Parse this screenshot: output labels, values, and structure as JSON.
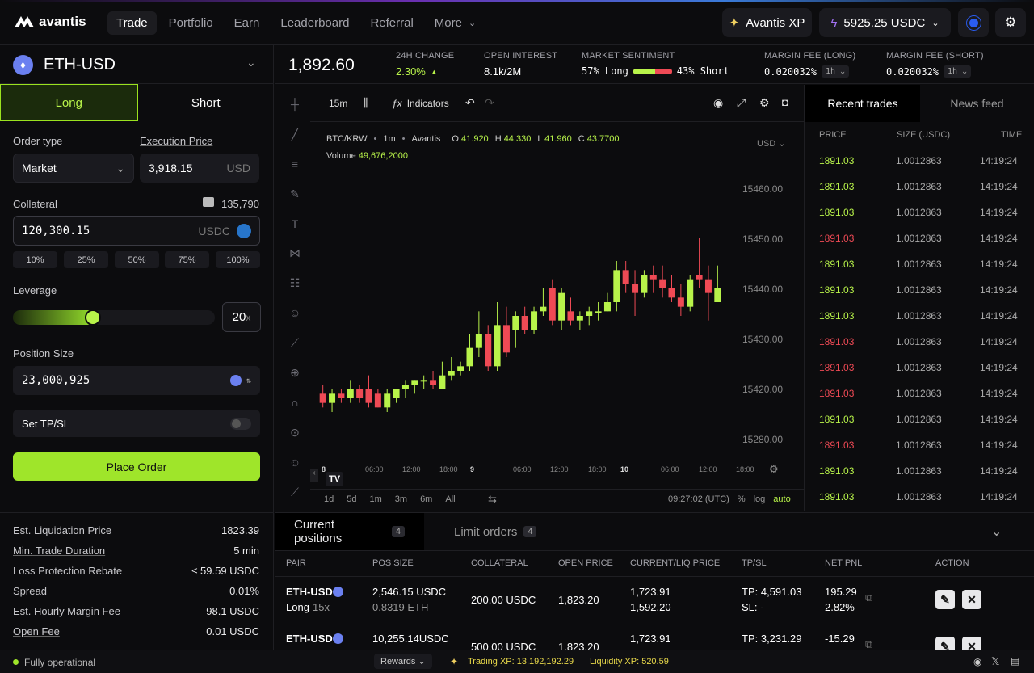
{
  "nav": {
    "brand": "avantis",
    "links": [
      "Trade",
      "Portfolio",
      "Earn",
      "Leaderboard",
      "Referral",
      "More"
    ],
    "xp_label": "Avantis XP",
    "balance": "5925.25 USDC"
  },
  "pair": {
    "name": "ETH-USD"
  },
  "order": {
    "tab_long": "Long",
    "tab_short": "Short",
    "order_type_label": "Order type",
    "order_type": "Market",
    "exec_price_label": "Execution Price",
    "exec_price": "3,918.15",
    "exec_unit": "USD",
    "collateral_label": "Collateral",
    "wallet_balance": "135,790",
    "collateral": "120,300.15",
    "collateral_unit": "USDC",
    "pcts": [
      "10%",
      "25%",
      "50%",
      "75%",
      "100%"
    ],
    "leverage_label": "Leverage",
    "leverage": "20",
    "leverage_unit": "x",
    "leverage_fill": 0.38,
    "size_label": "Position Size",
    "size": "23,000,925",
    "tpsl_label": "Set TP/SL",
    "place": "Place Order"
  },
  "stats": {
    "price": "1,892.60",
    "change_label": "24H CHANGE",
    "change": "2.30%",
    "oi_label": "OPEN INTEREST",
    "oi": "8.1k/2M",
    "sent_label": "MARKET SENTIMENT",
    "long": "57% Long",
    "short": "43% Short",
    "long_frac": 0.57,
    "fee_long_label": "MARGIN FEE (LONG)",
    "fee_long": "0.020032%",
    "fee_short_label": "MARGIN FEE (SHORT)",
    "fee_short": "0.020032%",
    "interval": "1h"
  },
  "chart": {
    "interval": "15m",
    "indicators": "Indicators",
    "legend_pair": "BTC/KRW",
    "legend_tf": "1m",
    "legend_src": "Avantis",
    "o": "41.920",
    "h": "44.330",
    "l": "41.960",
    "c": "43.7700",
    "volume_label": "Volume",
    "volume": "49,676,2000",
    "currency": "USD",
    "yticks": [
      "15460.00",
      "15450.00",
      "15440.00",
      "15430.00",
      "15420.00",
      "15280.00"
    ],
    "xticks": [
      "8",
      "06:00",
      "12:00",
      "18:00",
      "9",
      "06:00",
      "12:00",
      "18:00",
      "10",
      "06:00",
      "12:00",
      "18:00"
    ],
    "ranges": [
      "1d",
      "5d",
      "1m",
      "3m",
      "6m",
      "All"
    ],
    "time": "09:27:02 (UTC)",
    "pct": "%",
    "log": "log",
    "auto": "auto"
  },
  "chart_data": {
    "type": "candlestick",
    "yunit": "USD",
    "ylim": [
      15410,
      15470
    ],
    "candles": [
      [
        15423,
        15425,
        15420,
        15421
      ],
      [
        15421,
        15424,
        15419,
        15423
      ],
      [
        15423,
        15424,
        15421,
        15422
      ],
      [
        15422,
        15426,
        15421,
        15424
      ],
      [
        15424,
        15425,
        15421,
        15422
      ],
      [
        15424,
        15427,
        15420,
        15421
      ],
      [
        15423,
        15424,
        15420,
        15420
      ],
      [
        15420,
        15424,
        15419,
        15423
      ],
      [
        15422,
        15424,
        15421,
        15424
      ],
      [
        15424,
        15426,
        15422,
        15425
      ],
      [
        15425,
        15426,
        15423,
        15426
      ],
      [
        15426,
        15427,
        15424,
        15426
      ],
      [
        15426,
        15428,
        15424,
        15425
      ],
      [
        15424,
        15430,
        15424,
        15427
      ],
      [
        15427,
        15431,
        15426,
        15428
      ],
      [
        15428,
        15430,
        15427,
        15429
      ],
      [
        15429,
        15436,
        15428,
        15433
      ],
      [
        15433,
        15441,
        15431,
        15436
      ],
      [
        15436,
        15438,
        15428,
        15429
      ],
      [
        15429,
        15443,
        15428,
        15438
      ],
      [
        15438,
        15442,
        15431,
        15432
      ],
      [
        15437,
        15441,
        15433,
        15440
      ],
      [
        15440,
        15442,
        15436,
        15437
      ],
      [
        15437,
        15442,
        15436,
        15441
      ],
      [
        15441,
        15446,
        15440,
        15442
      ],
      [
        15446,
        15448,
        15438,
        15439
      ],
      [
        15439,
        15446,
        15437,
        15445
      ],
      [
        15441,
        15444,
        15438,
        15439
      ],
      [
        15439,
        15441,
        15437,
        15440
      ],
      [
        15440,
        15442,
        15438,
        15441
      ],
      [
        15441,
        15443,
        15439,
        15441
      ],
      [
        15441,
        15445,
        15441,
        15443
      ],
      [
        15443,
        15452,
        15441,
        15450
      ],
      [
        15450,
        15452,
        15445,
        15447
      ],
      [
        15447,
        15450,
        15440,
        15445
      ],
      [
        15445,
        15450,
        15444,
        15449
      ],
      [
        15449,
        15451,
        15445,
        15448
      ],
      [
        15448,
        15451,
        15444,
        15446
      ],
      [
        15446,
        15449,
        15443,
        15444
      ],
      [
        15444,
        15447,
        15440,
        15442
      ],
      [
        15442,
        15449,
        15441,
        15448
      ],
      [
        15449,
        15457,
        15446,
        15448
      ],
      [
        15448,
        15451,
        15439,
        15445
      ],
      [
        15443,
        15451,
        15443,
        15446
      ]
    ]
  },
  "trades": {
    "tab1": "Recent trades",
    "tab2": "News feed",
    "h_price": "PRICE",
    "h_size": "SIZE (USDC)",
    "h_time": "TIME",
    "rows": [
      {
        "p": "1891.03",
        "s": "1.0012863",
        "t": "14:19:24",
        "side": "g"
      },
      {
        "p": "1891.03",
        "s": "1.0012863",
        "t": "14:19:24",
        "side": "g"
      },
      {
        "p": "1891.03",
        "s": "1.0012863",
        "t": "14:19:24",
        "side": "g"
      },
      {
        "p": "1891.03",
        "s": "1.0012863",
        "t": "14:19:24",
        "side": "r"
      },
      {
        "p": "1891.03",
        "s": "1.0012863",
        "t": "14:19:24",
        "side": "g"
      },
      {
        "p": "1891.03",
        "s": "1.0012863",
        "t": "14:19:24",
        "side": "g"
      },
      {
        "p": "1891.03",
        "s": "1.0012863",
        "t": "14:19:24",
        "side": "g"
      },
      {
        "p": "1891.03",
        "s": "1.0012863",
        "t": "14:19:24",
        "side": "r"
      },
      {
        "p": "1891.03",
        "s": "1.0012863",
        "t": "14:19:24",
        "side": "r"
      },
      {
        "p": "1891.03",
        "s": "1.0012863",
        "t": "14:19:24",
        "side": "r"
      },
      {
        "p": "1891.03",
        "s": "1.0012863",
        "t": "14:19:24",
        "side": "g"
      },
      {
        "p": "1891.03",
        "s": "1.0012863",
        "t": "14:19:24",
        "side": "r"
      },
      {
        "p": "1891.03",
        "s": "1.0012863",
        "t": "14:19:24",
        "side": "g"
      },
      {
        "p": "1891.03",
        "s": "1.0012863",
        "t": "14:19:24",
        "side": "g"
      }
    ]
  },
  "info": {
    "rows": [
      {
        "k": "Est. Liquidation Price",
        "v": "1823.39",
        "ul": false,
        "c": ""
      },
      {
        "k": "Min. Trade Duration",
        "v": "5 min",
        "ul": true,
        "c": "yellow"
      },
      {
        "k": "Loss Protection Rebate",
        "v": "≤ 59.59 USDC",
        "ul": false,
        "c": "green"
      },
      {
        "k": "Spread",
        "v": "0.01%",
        "ul": false,
        "c": ""
      },
      {
        "k": "Est. Hourly Margin Fee",
        "v": "98.1 USDC",
        "ul": false,
        "c": ""
      },
      {
        "k": "Open Fee",
        "v": "0.01 USDC",
        "ul": true,
        "c": ""
      }
    ]
  },
  "positions": {
    "tab1": "Current positions",
    "n1": "4",
    "tab2": "Limit orders",
    "n2": "4",
    "headers": [
      "PAIR",
      "POS SIZE",
      "COLLATERAL",
      "OPEN PRICE",
      "CURRENT/LIQ PRICE",
      "TP/SL",
      "NET PNL",
      "ACTION"
    ],
    "rows": [
      {
        "pair": "ETH-USD",
        "side": "Long",
        "lev": "15x",
        "size": "2,546.15 USDC",
        "size2": "0.8319 ETH",
        "coll": "200.00 USDC",
        "open": "1,823.20",
        "cur": "1,723.91",
        "liq": "1,592.20",
        "tp": "TP: 4,591.03",
        "sl": "SL: -",
        "pnl": "195.29",
        "pnl2": "2.82%",
        "pc": "green"
      },
      {
        "pair": "ETH-USD",
        "side": "",
        "lev": "",
        "size": "10,255.14USDC",
        "size2": "",
        "coll": "500.00 USDC",
        "open": "1,823.20",
        "cur": "1,723.91",
        "liq": "",
        "tp": "TP: 3,231.29",
        "sl": "",
        "pnl": "-15.29",
        "pnl2": "",
        "pc": "red"
      }
    ]
  },
  "footer": {
    "status": "Fully operational",
    "rewards": "Rewards",
    "trading_xp": "Trading XP: 13,192,192.29",
    "liq_xp": "Liquidity XP: 520.59"
  }
}
